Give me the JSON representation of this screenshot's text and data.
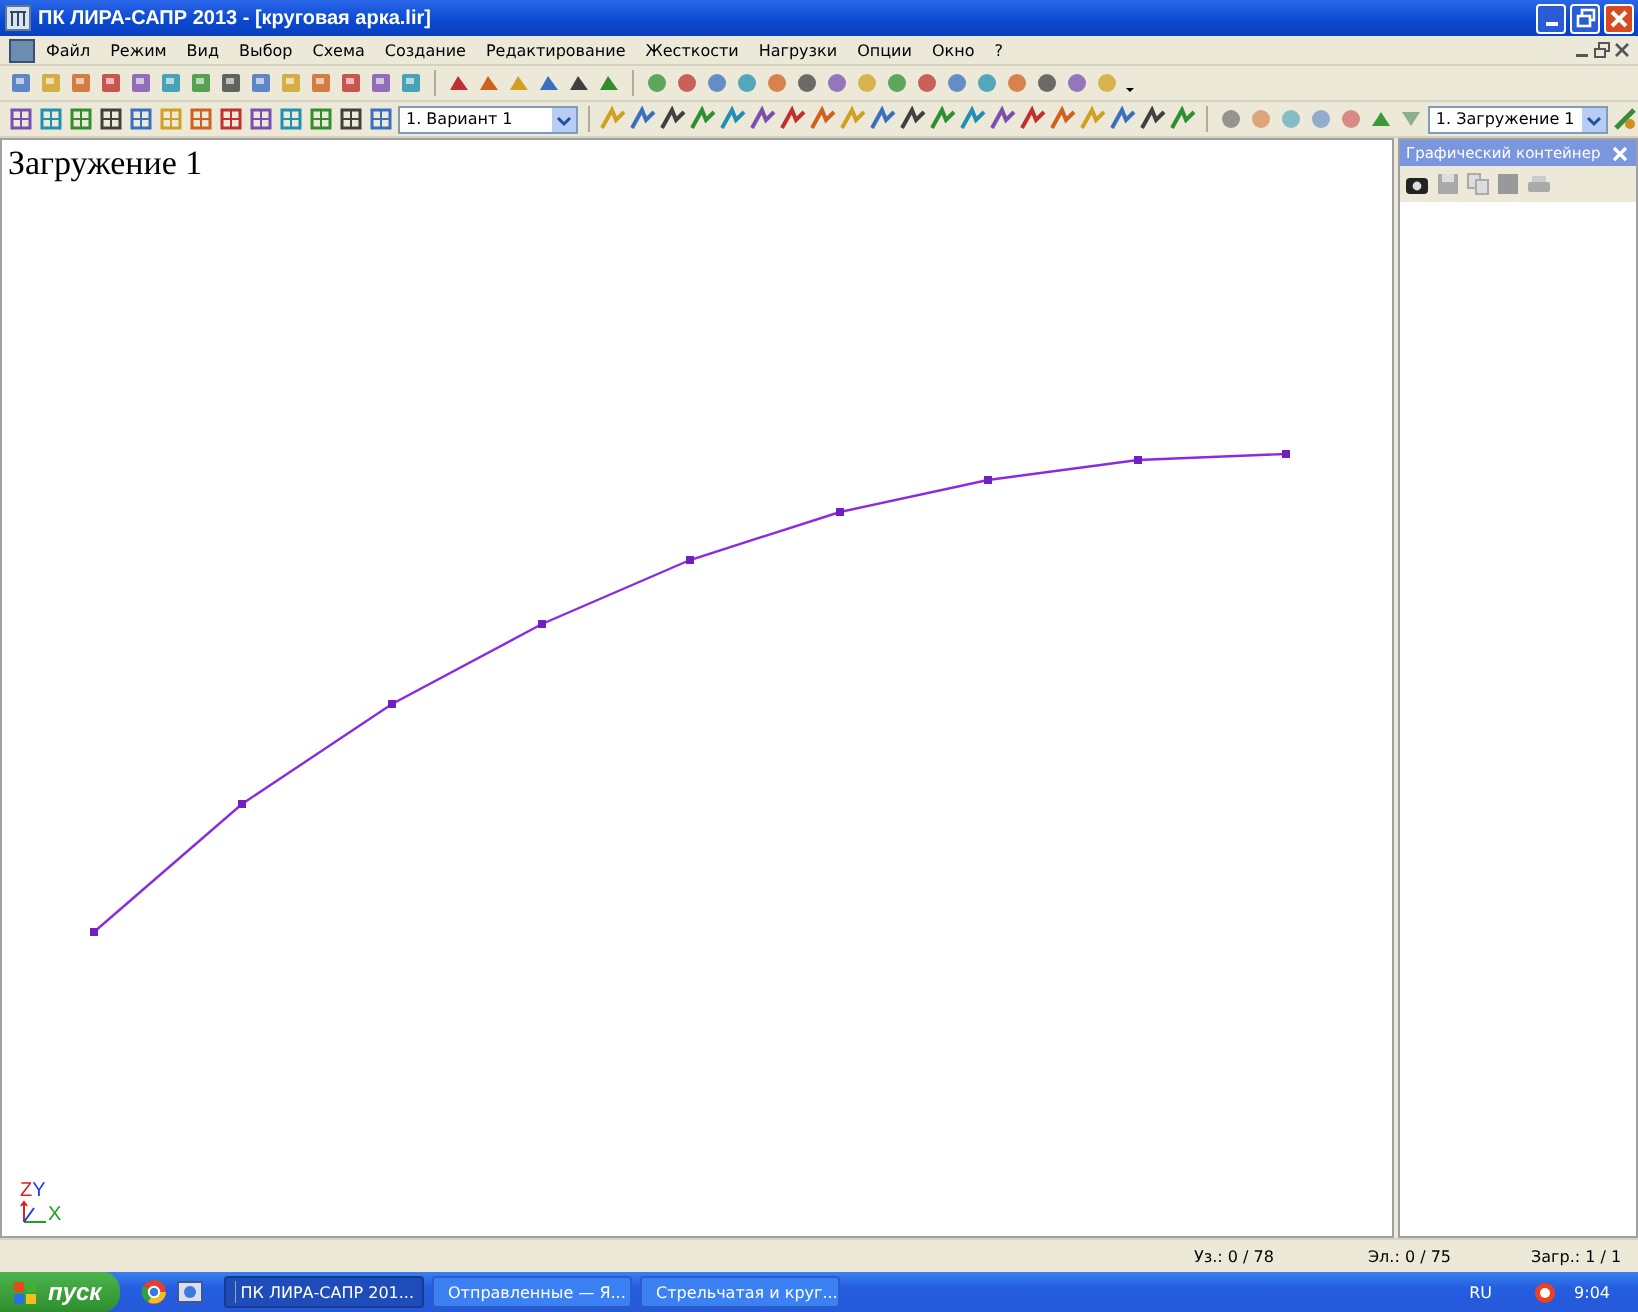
{
  "window": {
    "title": "ПК ЛИРА-САПР  2013 - [круговая арка.lir]"
  },
  "menu": [
    "Файл",
    "Режим",
    "Вид",
    "Выбор",
    "Схема",
    "Создание",
    "Редактирование",
    "Жесткости",
    "Нагрузки",
    "Опции",
    "Окно",
    "?"
  ],
  "toolbar": {
    "variant_combo": "1. Вариант 1",
    "load_combo": "1. Загружение 1"
  },
  "canvas": {
    "heading": "Загружение 1",
    "axes": {
      "z": "Z",
      "y": "Y",
      "x": "X"
    }
  },
  "side_panel": {
    "title": "Графический контейнер"
  },
  "status_bar": [
    "Уз.: 0 / 78",
    "Эл.: 0 / 75",
    "Загр.: 1 / 1"
  ],
  "taskbar": {
    "start": "пуск",
    "tasks": [
      {
        "label": "ПК ЛИРА-САПР  201...",
        "selected": true
      },
      {
        "label": "Отправленные — Я...",
        "selected": false
      },
      {
        "label": "Стрельчатая и круг...",
        "selected": false
      }
    ],
    "language": "RU",
    "clock": "9:04"
  }
}
